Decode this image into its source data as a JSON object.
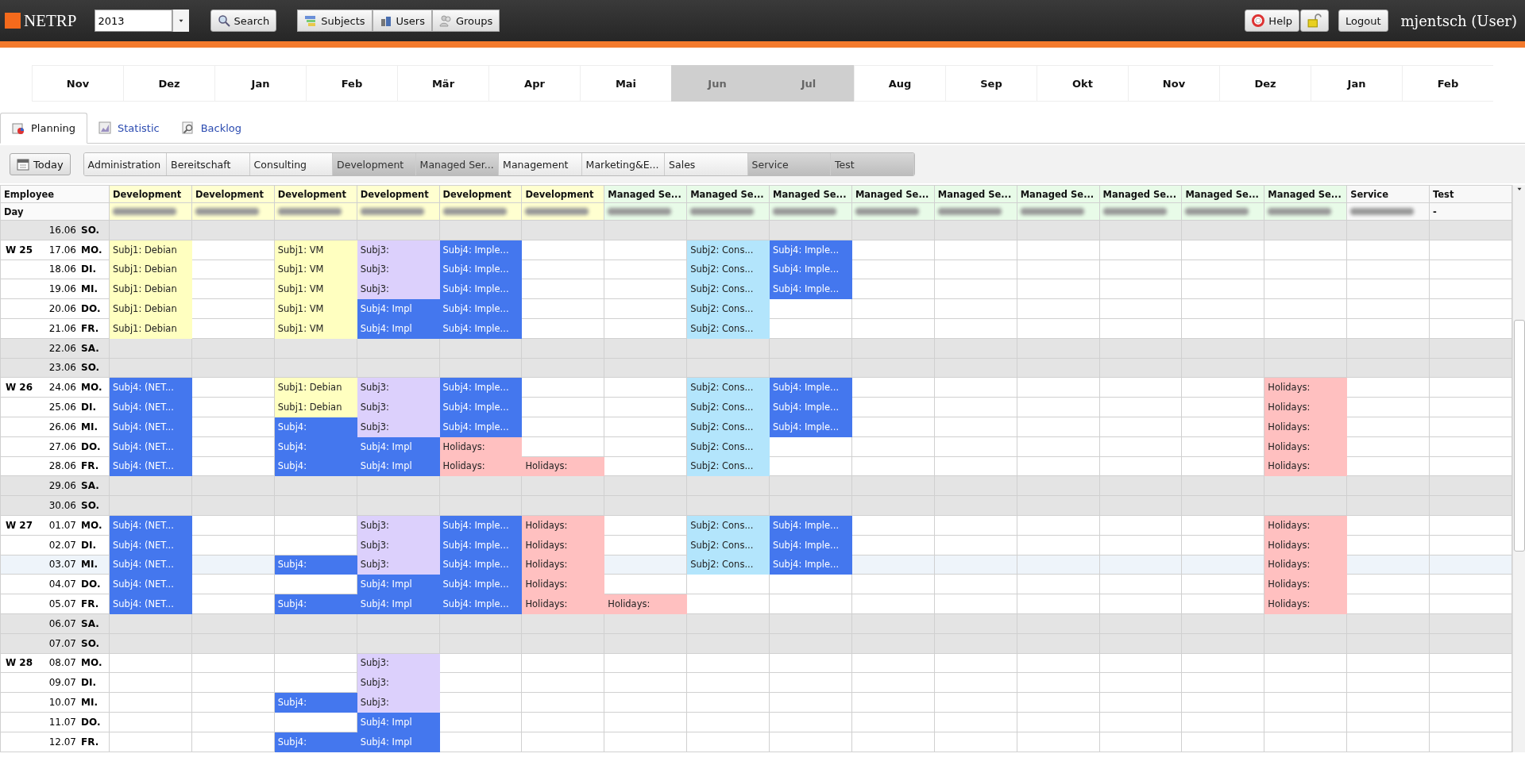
{
  "top_bar": {
    "logo": "NETRP",
    "year": {
      "value": "2013"
    },
    "search_button": "Search",
    "nav_buttons": [
      "Subjects",
      "Users",
      "Groups"
    ],
    "help_button": "Help",
    "logout_button": "Logout",
    "user": "mjentsch (User)"
  },
  "months": [
    {
      "label": "Nov",
      "selected": false
    },
    {
      "label": "Dez",
      "selected": false
    },
    {
      "label": "Jan",
      "selected": false
    },
    {
      "label": "Feb",
      "selected": false
    },
    {
      "label": "Mär",
      "selected": false
    },
    {
      "label": "Apr",
      "selected": false
    },
    {
      "label": "Mai",
      "selected": false
    },
    {
      "label": "Jun",
      "selected": true
    },
    {
      "label": "Jul",
      "selected": true
    },
    {
      "label": "Aug",
      "selected": false
    },
    {
      "label": "Sep",
      "selected": false
    },
    {
      "label": "Okt",
      "selected": false
    },
    {
      "label": "Nov",
      "selected": false
    },
    {
      "label": "Dez",
      "selected": false
    },
    {
      "label": "Jan",
      "selected": false
    },
    {
      "label": "Feb",
      "selected": false
    }
  ],
  "tabs": [
    {
      "label": "Planning",
      "selected": true
    },
    {
      "label": "Statistic",
      "selected": false
    },
    {
      "label": "Backlog",
      "selected": false
    }
  ],
  "today_button": "Today",
  "groups": [
    {
      "label": "Administration",
      "selected": false
    },
    {
      "label": "Bereitschaft",
      "selected": false
    },
    {
      "label": "Consulting",
      "selected": false
    },
    {
      "label": "Development",
      "selected": true
    },
    {
      "label": "Managed Ser...",
      "selected": true
    },
    {
      "label": "Management",
      "selected": false
    },
    {
      "label": "Marketing&E...",
      "selected": false
    },
    {
      "label": "Sales",
      "selected": false
    },
    {
      "label": "Service",
      "selected": true
    },
    {
      "label": "Test",
      "selected": true
    }
  ],
  "table": {
    "corner": [
      "Employee",
      "Day"
    ],
    "columns": [
      {
        "group": "Development",
        "color": "#ffffd0",
        "redacted": true
      },
      {
        "group": "Development",
        "color": "#ffffd0",
        "redacted": true
      },
      {
        "group": "Development",
        "color": "#ffffd0",
        "redacted": true
      },
      {
        "group": "Development",
        "color": "#ffffd0",
        "redacted": true
      },
      {
        "group": "Development",
        "color": "#ffffd0",
        "redacted": true
      },
      {
        "group": "Development",
        "color": "#ffffd0",
        "redacted": true
      },
      {
        "group": "Managed Se...",
        "color": "#e8fbe8",
        "redacted": true
      },
      {
        "group": "Managed Se...",
        "color": "#e8fbe8",
        "redacted": true
      },
      {
        "group": "Managed Se...",
        "color": "#e8fbe8",
        "redacted": true
      },
      {
        "group": "Managed Se...",
        "color": "#e8fbe8",
        "redacted": true
      },
      {
        "group": "Managed Se...",
        "color": "#e8fbe8",
        "redacted": true
      },
      {
        "group": "Managed Se...",
        "color": "#e8fbe8",
        "redacted": true
      },
      {
        "group": "Managed Se...",
        "color": "#e8fbe8",
        "redacted": true
      },
      {
        "group": "Managed Se...",
        "color": "#e8fbe8",
        "redacted": true
      },
      {
        "group": "Managed Se...",
        "color": "#e8fbe8",
        "redacted": true
      },
      {
        "group": "Service",
        "color": "#f8f8f8",
        "redacted": true
      },
      {
        "group": "Test",
        "color": "#f8f8f8",
        "employee": "-"
      }
    ],
    "rows": [
      {
        "date": "16.06",
        "day": "SO.",
        "weekend": true,
        "selected": false
      },
      {
        "week": "W 25",
        "date": "17.06",
        "day": "MO.",
        "weekend": false,
        "selected": false,
        "cells": [
          {
            "kind": "subj1",
            "text": "Subj1: Debian"
          },
          {
            "kind": "blank"
          },
          {
            "kind": "subj1",
            "text": "Subj1: VM"
          },
          {
            "kind": "subj3",
            "text": "Subj3:"
          },
          {
            "kind": "subj4",
            "text": "Subj4: Imple..."
          },
          {
            "kind": "blank"
          },
          {
            "kind": "blank"
          },
          {
            "kind": "subj2",
            "text": "Subj2: Cons..."
          },
          {
            "kind": "subj4",
            "text": "Subj4: Imple..."
          },
          {
            "kind": "blank"
          },
          {
            "kind": "blank"
          },
          {
            "kind": "blank"
          },
          {
            "kind": "blank"
          },
          {
            "kind": "blank"
          },
          {
            "kind": "blank"
          },
          {
            "kind": "blank"
          },
          {
            "kind": "blank"
          }
        ]
      },
      {
        "date": "18.06",
        "day": "DI.",
        "weekend": false,
        "selected": false,
        "cells": [
          {
            "kind": "subj1",
            "text": "Subj1: Debian"
          },
          {
            "kind": "blank"
          },
          {
            "kind": "subj1",
            "text": "Subj1: VM"
          },
          {
            "kind": "subj3",
            "text": "Subj3:"
          },
          {
            "kind": "subj4",
            "text": "Subj4: Imple..."
          },
          {
            "kind": "blank"
          },
          {
            "kind": "blank"
          },
          {
            "kind": "subj2",
            "text": "Subj2: Cons..."
          },
          {
            "kind": "subj4",
            "text": "Subj4: Imple..."
          },
          {
            "kind": "blank"
          },
          {
            "kind": "blank"
          },
          {
            "kind": "blank"
          },
          {
            "kind": "blank"
          },
          {
            "kind": "blank"
          },
          {
            "kind": "blank"
          },
          {
            "kind": "blank"
          },
          {
            "kind": "blank"
          }
        ]
      },
      {
        "date": "19.06",
        "day": "MI.",
        "weekend": false,
        "selected": false,
        "cells": [
          {
            "kind": "subj1",
            "text": "Subj1: Debian"
          },
          {
            "kind": "blank"
          },
          {
            "kind": "subj1",
            "text": "Subj1: VM"
          },
          {
            "kind": "subj3",
            "text": "Subj3:"
          },
          {
            "kind": "subj4",
            "text": "Subj4: Imple..."
          },
          {
            "kind": "blank"
          },
          {
            "kind": "blank"
          },
          {
            "kind": "subj2",
            "text": "Subj2: Cons..."
          },
          {
            "kind": "subj4",
            "text": "Subj4: Imple..."
          },
          {
            "kind": "blank"
          },
          {
            "kind": "blank"
          },
          {
            "kind": "blank"
          },
          {
            "kind": "blank"
          },
          {
            "kind": "blank"
          },
          {
            "kind": "blank"
          },
          {
            "kind": "blank"
          },
          {
            "kind": "blank"
          }
        ]
      },
      {
        "date": "20.06",
        "day": "DO.",
        "weekend": false,
        "selected": false,
        "cells": [
          {
            "kind": "subj1",
            "text": "Subj1: Debian"
          },
          {
            "kind": "blank"
          },
          {
            "kind": "subj1",
            "text": "Subj1: VM"
          },
          {
            "kind": "subj4",
            "text": "Subj4: Impl"
          },
          {
            "kind": "subj4",
            "text": "Subj4: Imple..."
          },
          {
            "kind": "blank"
          },
          {
            "kind": "blank"
          },
          {
            "kind": "subj2",
            "text": "Subj2: Cons..."
          },
          {
            "kind": "blank"
          },
          {
            "kind": "blank"
          },
          {
            "kind": "blank"
          },
          {
            "kind": "blank"
          },
          {
            "kind": "blank"
          },
          {
            "kind": "blank"
          },
          {
            "kind": "blank"
          },
          {
            "kind": "blank"
          },
          {
            "kind": "blank"
          }
        ]
      },
      {
        "date": "21.06",
        "day": "FR.",
        "weekend": false,
        "selected": false,
        "cells": [
          {
            "kind": "subj1",
            "text": "Subj1: Debian"
          },
          {
            "kind": "blank"
          },
          {
            "kind": "subj1",
            "text": "Subj1: VM"
          },
          {
            "kind": "subj4",
            "text": "Subj4: Impl"
          },
          {
            "kind": "subj4",
            "text": "Subj4: Imple..."
          },
          {
            "kind": "blank"
          },
          {
            "kind": "blank"
          },
          {
            "kind": "subj2",
            "text": "Subj2: Cons..."
          },
          {
            "kind": "blank"
          },
          {
            "kind": "blank"
          },
          {
            "kind": "blank"
          },
          {
            "kind": "blank"
          },
          {
            "kind": "blank"
          },
          {
            "kind": "blank"
          },
          {
            "kind": "blank"
          },
          {
            "kind": "blank"
          },
          {
            "kind": "blank"
          }
        ]
      },
      {
        "date": "22.06",
        "day": "SA.",
        "weekend": true,
        "selected": false
      },
      {
        "date": "23.06",
        "day": "SO.",
        "weekend": true,
        "selected": false
      },
      {
        "week": "W 26",
        "date": "24.06",
        "day": "MO.",
        "weekend": false,
        "selected": false,
        "cells": [
          {
            "kind": "subj4",
            "text": "Subj4: (NET..."
          },
          {
            "kind": "blank"
          },
          {
            "kind": "subj1",
            "text": "Subj1: Debian"
          },
          {
            "kind": "subj3",
            "text": "Subj3:"
          },
          {
            "kind": "subj4",
            "text": "Subj4: Imple..."
          },
          {
            "kind": "blank"
          },
          {
            "kind": "blank"
          },
          {
            "kind": "subj2",
            "text": "Subj2: Cons..."
          },
          {
            "kind": "subj4",
            "text": "Subj4: Imple..."
          },
          {
            "kind": "blank"
          },
          {
            "kind": "blank"
          },
          {
            "kind": "blank"
          },
          {
            "kind": "blank"
          },
          {
            "kind": "blank"
          },
          {
            "kind": "holiday",
            "text": "Holidays:"
          },
          {
            "kind": "blank"
          },
          {
            "kind": "blank"
          }
        ]
      },
      {
        "date": "25.06",
        "day": "DI.",
        "weekend": false,
        "selected": false,
        "cells": [
          {
            "kind": "subj4",
            "text": "Subj4: (NET..."
          },
          {
            "kind": "blank"
          },
          {
            "kind": "subj1",
            "text": "Subj1: Debian"
          },
          {
            "kind": "subj3",
            "text": "Subj3:"
          },
          {
            "kind": "subj4",
            "text": "Subj4: Imple..."
          },
          {
            "kind": "blank"
          },
          {
            "kind": "blank"
          },
          {
            "kind": "subj2",
            "text": "Subj2: Cons..."
          },
          {
            "kind": "subj4",
            "text": "Subj4: Imple..."
          },
          {
            "kind": "blank"
          },
          {
            "kind": "blank"
          },
          {
            "kind": "blank"
          },
          {
            "kind": "blank"
          },
          {
            "kind": "blank"
          },
          {
            "kind": "holiday",
            "text": "Holidays:"
          },
          {
            "kind": "blank"
          },
          {
            "kind": "blank"
          }
        ]
      },
      {
        "date": "26.06",
        "day": "MI.",
        "weekend": false,
        "selected": false,
        "cells": [
          {
            "kind": "subj4",
            "text": "Subj4: (NET..."
          },
          {
            "kind": "blank"
          },
          {
            "kind": "subj4",
            "text": "Subj4:"
          },
          {
            "kind": "subj3",
            "text": "Subj3:"
          },
          {
            "kind": "subj4",
            "text": "Subj4: Imple..."
          },
          {
            "kind": "blank"
          },
          {
            "kind": "blank"
          },
          {
            "kind": "subj2",
            "text": "Subj2: Cons..."
          },
          {
            "kind": "subj4",
            "text": "Subj4: Imple..."
          },
          {
            "kind": "blank"
          },
          {
            "kind": "blank"
          },
          {
            "kind": "blank"
          },
          {
            "kind": "blank"
          },
          {
            "kind": "blank"
          },
          {
            "kind": "holiday",
            "text": "Holidays:"
          },
          {
            "kind": "blank"
          },
          {
            "kind": "blank"
          }
        ]
      },
      {
        "date": "27.06",
        "day": "DO.",
        "weekend": false,
        "selected": false,
        "cells": [
          {
            "kind": "subj4",
            "text": "Subj4: (NET..."
          },
          {
            "kind": "blank"
          },
          {
            "kind": "subj4",
            "text": "Subj4:"
          },
          {
            "kind": "subj4",
            "text": "Subj4: Impl"
          },
          {
            "kind": "holiday",
            "text": "Holidays:"
          },
          {
            "kind": "blank"
          },
          {
            "kind": "blank"
          },
          {
            "kind": "subj2",
            "text": "Subj2: Cons..."
          },
          {
            "kind": "blank"
          },
          {
            "kind": "blank"
          },
          {
            "kind": "blank"
          },
          {
            "kind": "blank"
          },
          {
            "kind": "blank"
          },
          {
            "kind": "blank"
          },
          {
            "kind": "holiday",
            "text": "Holidays:"
          },
          {
            "kind": "blank"
          },
          {
            "kind": "blank"
          }
        ]
      },
      {
        "date": "28.06",
        "day": "FR.",
        "weekend": false,
        "selected": false,
        "cells": [
          {
            "kind": "subj4",
            "text": "Subj4: (NET..."
          },
          {
            "kind": "blank"
          },
          {
            "kind": "subj4",
            "text": "Subj4:"
          },
          {
            "kind": "subj4",
            "text": "Subj4: Impl"
          },
          {
            "kind": "holiday",
            "text": "Holidays:"
          },
          {
            "kind": "holiday",
            "text": "Holidays:"
          },
          {
            "kind": "blank"
          },
          {
            "kind": "subj2",
            "text": "Subj2: Cons..."
          },
          {
            "kind": "blank"
          },
          {
            "kind": "blank"
          },
          {
            "kind": "blank"
          },
          {
            "kind": "blank"
          },
          {
            "kind": "blank"
          },
          {
            "kind": "blank"
          },
          {
            "kind": "holiday",
            "text": "Holidays:"
          },
          {
            "kind": "blank"
          },
          {
            "kind": "blank"
          }
        ]
      },
      {
        "date": "29.06",
        "day": "SA.",
        "weekend": true,
        "selected": false
      },
      {
        "date": "30.06",
        "day": "SO.",
        "weekend": true,
        "selected": false
      },
      {
        "week": "W 27",
        "date": "01.07",
        "day": "MO.",
        "weekend": false,
        "selected": false,
        "cells": [
          {
            "kind": "subj4",
            "text": "Subj4: (NET..."
          },
          {
            "kind": "blank"
          },
          {
            "kind": "blank"
          },
          {
            "kind": "subj3",
            "text": "Subj3:"
          },
          {
            "kind": "subj4",
            "text": "Subj4: Imple..."
          },
          {
            "kind": "holiday",
            "text": "Holidays:"
          },
          {
            "kind": "blank"
          },
          {
            "kind": "subj2",
            "text": "Subj2: Cons..."
          },
          {
            "kind": "subj4",
            "text": "Subj4: Imple..."
          },
          {
            "kind": "blank"
          },
          {
            "kind": "blank"
          },
          {
            "kind": "blank"
          },
          {
            "kind": "blank"
          },
          {
            "kind": "blank"
          },
          {
            "kind": "holiday",
            "text": "Holidays:"
          },
          {
            "kind": "blank"
          },
          {
            "kind": "blank"
          }
        ]
      },
      {
        "date": "02.07",
        "day": "DI.",
        "weekend": false,
        "selected": false,
        "cells": [
          {
            "kind": "subj4",
            "text": "Subj4: (NET..."
          },
          {
            "kind": "blank"
          },
          {
            "kind": "blank"
          },
          {
            "kind": "subj3",
            "text": "Subj3:"
          },
          {
            "kind": "subj4",
            "text": "Subj4: Imple..."
          },
          {
            "kind": "holiday",
            "text": "Holidays:"
          },
          {
            "kind": "blank"
          },
          {
            "kind": "subj2",
            "text": "Subj2: Cons..."
          },
          {
            "kind": "subj4",
            "text": "Subj4: Imple..."
          },
          {
            "kind": "blank"
          },
          {
            "kind": "blank"
          },
          {
            "kind": "blank"
          },
          {
            "kind": "blank"
          },
          {
            "kind": "blank"
          },
          {
            "kind": "holiday",
            "text": "Holidays:"
          },
          {
            "kind": "blank"
          },
          {
            "kind": "blank"
          }
        ]
      },
      {
        "date": "03.07",
        "day": "MI.",
        "weekend": false,
        "selected": true,
        "cells": [
          {
            "kind": "subj4",
            "text": "Subj4: (NET..."
          },
          {
            "kind": "blank"
          },
          {
            "kind": "subj4",
            "text": "Subj4:"
          },
          {
            "kind": "subj3",
            "text": "Subj3:"
          },
          {
            "kind": "subj4",
            "text": "Subj4: Imple..."
          },
          {
            "kind": "holiday",
            "text": "Holidays:"
          },
          {
            "kind": "blank"
          },
          {
            "kind": "subj2",
            "text": "Subj2: Cons..."
          },
          {
            "kind": "subj4",
            "text": "Subj4: Imple..."
          },
          {
            "kind": "blank"
          },
          {
            "kind": "blank"
          },
          {
            "kind": "blank"
          },
          {
            "kind": "blank"
          },
          {
            "kind": "blank"
          },
          {
            "kind": "holiday",
            "text": "Holidays:"
          },
          {
            "kind": "blank"
          },
          {
            "kind": "blank"
          }
        ]
      },
      {
        "date": "04.07",
        "day": "DO.",
        "weekend": false,
        "selected": false,
        "cells": [
          {
            "kind": "subj4",
            "text": "Subj4: (NET..."
          },
          {
            "kind": "blank"
          },
          {
            "kind": "blank"
          },
          {
            "kind": "subj4",
            "text": "Subj4: Impl"
          },
          {
            "kind": "subj4",
            "text": "Subj4: Imple..."
          },
          {
            "kind": "holiday",
            "text": "Holidays:"
          },
          {
            "kind": "blank"
          },
          {
            "kind": "blank"
          },
          {
            "kind": "blank"
          },
          {
            "kind": "blank"
          },
          {
            "kind": "blank"
          },
          {
            "kind": "blank"
          },
          {
            "kind": "blank"
          },
          {
            "kind": "blank"
          },
          {
            "kind": "holiday",
            "text": "Holidays:"
          },
          {
            "kind": "blank"
          },
          {
            "kind": "blank"
          }
        ]
      },
      {
        "date": "05.07",
        "day": "FR.",
        "weekend": false,
        "selected": false,
        "cells": [
          {
            "kind": "subj4",
            "text": "Subj4: (NET..."
          },
          {
            "kind": "blank"
          },
          {
            "kind": "subj4",
            "text": "Subj4:"
          },
          {
            "kind": "subj4",
            "text": "Subj4: Impl"
          },
          {
            "kind": "subj4",
            "text": "Subj4: Imple..."
          },
          {
            "kind": "holiday",
            "text": "Holidays:"
          },
          {
            "kind": "holiday",
            "text": "Holidays:"
          },
          {
            "kind": "blank"
          },
          {
            "kind": "blank"
          },
          {
            "kind": "blank"
          },
          {
            "kind": "blank"
          },
          {
            "kind": "blank"
          },
          {
            "kind": "blank"
          },
          {
            "kind": "blank"
          },
          {
            "kind": "holiday",
            "text": "Holidays:"
          },
          {
            "kind": "blank"
          },
          {
            "kind": "blank"
          }
        ]
      },
      {
        "date": "06.07",
        "day": "SA.",
        "weekend": true,
        "selected": false
      },
      {
        "date": "07.07",
        "day": "SO.",
        "weekend": true,
        "selected": false
      },
      {
        "week": "W 28",
        "date": "08.07",
        "day": "MO.",
        "weekend": false,
        "selected": false,
        "cells": [
          {
            "kind": "blank"
          },
          {
            "kind": "blank"
          },
          {
            "kind": "blank"
          },
          {
            "kind": "subj3",
            "text": "Subj3:"
          },
          {
            "kind": "blank"
          },
          {
            "kind": "blank"
          },
          {
            "kind": "blank"
          },
          {
            "kind": "blank"
          },
          {
            "kind": "blank"
          },
          {
            "kind": "blank"
          },
          {
            "kind": "blank"
          },
          {
            "kind": "blank"
          },
          {
            "kind": "blank"
          },
          {
            "kind": "blank"
          },
          {
            "kind": "blank"
          },
          {
            "kind": "blank"
          },
          {
            "kind": "blank"
          }
        ]
      },
      {
        "date": "09.07",
        "day": "DI.",
        "weekend": false,
        "selected": false,
        "cells": [
          {
            "kind": "blank"
          },
          {
            "kind": "blank"
          },
          {
            "kind": "blank"
          },
          {
            "kind": "subj3",
            "text": "Subj3:"
          },
          {
            "kind": "blank"
          },
          {
            "kind": "blank"
          },
          {
            "kind": "blank"
          },
          {
            "kind": "blank"
          },
          {
            "kind": "blank"
          },
          {
            "kind": "blank"
          },
          {
            "kind": "blank"
          },
          {
            "kind": "blank"
          },
          {
            "kind": "blank"
          },
          {
            "kind": "blank"
          },
          {
            "kind": "blank"
          },
          {
            "kind": "blank"
          },
          {
            "kind": "blank"
          }
        ]
      },
      {
        "date": "10.07",
        "day": "MI.",
        "weekend": false,
        "selected": false,
        "cells": [
          {
            "kind": "blank"
          },
          {
            "kind": "blank"
          },
          {
            "kind": "subj4",
            "text": "Subj4:"
          },
          {
            "kind": "subj3",
            "text": "Subj3:"
          },
          {
            "kind": "blank"
          },
          {
            "kind": "blank"
          },
          {
            "kind": "blank"
          },
          {
            "kind": "blank"
          },
          {
            "kind": "blank"
          },
          {
            "kind": "blank"
          },
          {
            "kind": "blank"
          },
          {
            "kind": "blank"
          },
          {
            "kind": "blank"
          },
          {
            "kind": "blank"
          },
          {
            "kind": "blank"
          },
          {
            "kind": "blank"
          },
          {
            "kind": "blank"
          }
        ]
      },
      {
        "date": "11.07",
        "day": "DO.",
        "weekend": false,
        "selected": false,
        "cells": [
          {
            "kind": "blank"
          },
          {
            "kind": "blank"
          },
          {
            "kind": "blank"
          },
          {
            "kind": "subj4",
            "text": "Subj4: Impl"
          },
          {
            "kind": "blank"
          },
          {
            "kind": "blank"
          },
          {
            "kind": "blank"
          },
          {
            "kind": "blank"
          },
          {
            "kind": "blank"
          },
          {
            "kind": "blank"
          },
          {
            "kind": "blank"
          },
          {
            "kind": "blank"
          },
          {
            "kind": "blank"
          },
          {
            "kind": "blank"
          },
          {
            "kind": "blank"
          },
          {
            "kind": "blank"
          },
          {
            "kind": "blank"
          }
        ]
      },
      {
        "date": "12.07",
        "day": "FR.",
        "weekend": false,
        "selected": false,
        "cells": [
          {
            "kind": "blank"
          },
          {
            "kind": "blank"
          },
          {
            "kind": "subj4",
            "text": "Subj4:"
          },
          {
            "kind": "subj4",
            "text": "Subj4: Impl"
          },
          {
            "kind": "blank"
          },
          {
            "kind": "blank"
          },
          {
            "kind": "blank"
          },
          {
            "kind": "blank"
          },
          {
            "kind": "blank"
          },
          {
            "kind": "blank"
          },
          {
            "kind": "blank"
          },
          {
            "kind": "blank"
          },
          {
            "kind": "blank"
          },
          {
            "kind": "blank"
          },
          {
            "kind": "blank"
          },
          {
            "kind": "blank"
          },
          {
            "kind": "blank"
          }
        ]
      }
    ]
  }
}
